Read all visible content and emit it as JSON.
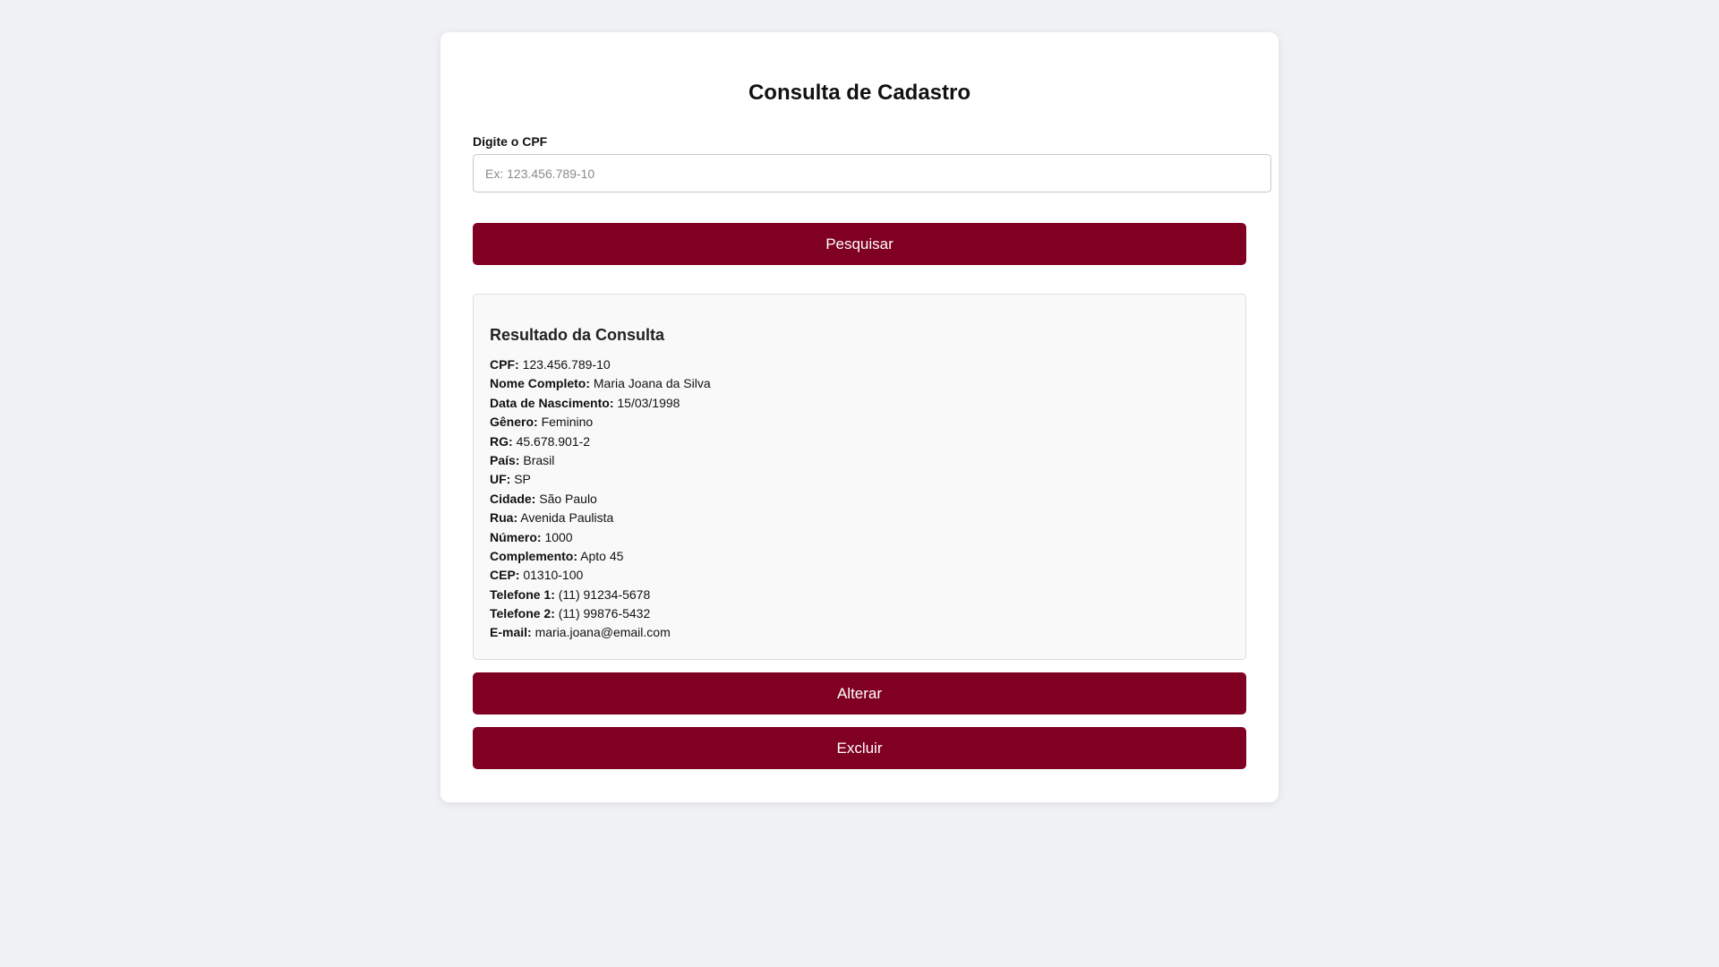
{
  "page": {
    "title": "Consulta de Cadastro"
  },
  "search": {
    "label": "Digite o CPF",
    "placeholder": "Ex: 123.456.789-10",
    "value": "",
    "button_label": "Pesquisar"
  },
  "result": {
    "title": "Resultado da Consulta",
    "fields": [
      {
        "label": "CPF:",
        "value": "123.456.789-10"
      },
      {
        "label": "Nome Completo:",
        "value": "Maria Joana da Silva"
      },
      {
        "label": "Data de Nascimento:",
        "value": "15/03/1998"
      },
      {
        "label": "Gênero:",
        "value": "Feminino"
      },
      {
        "label": "RG:",
        "value": "45.678.901-2"
      },
      {
        "label": "País:",
        "value": "Brasil"
      },
      {
        "label": "UF:",
        "value": "SP"
      },
      {
        "label": "Cidade:",
        "value": "São Paulo"
      },
      {
        "label": "Rua:",
        "value": "Avenida Paulista"
      },
      {
        "label": "Número:",
        "value": "1000"
      },
      {
        "label": "Complemento:",
        "value": "Apto 45"
      },
      {
        "label": "CEP:",
        "value": "01310-100"
      },
      {
        "label": "Telefone 1:",
        "value": "(11) 91234-5678"
      },
      {
        "label": "Telefone 2:",
        "value": "(11) 99876-5432"
      },
      {
        "label": "E-mail:",
        "value": "maria.joana@email.com"
      }
    ]
  },
  "actions": {
    "alter_label": "Alterar",
    "delete_label": "Excluir"
  },
  "colors": {
    "background": "#f0f1f4",
    "card": "#ffffff",
    "primary_button": "#7f0020",
    "result_background": "#f9f9f9"
  }
}
